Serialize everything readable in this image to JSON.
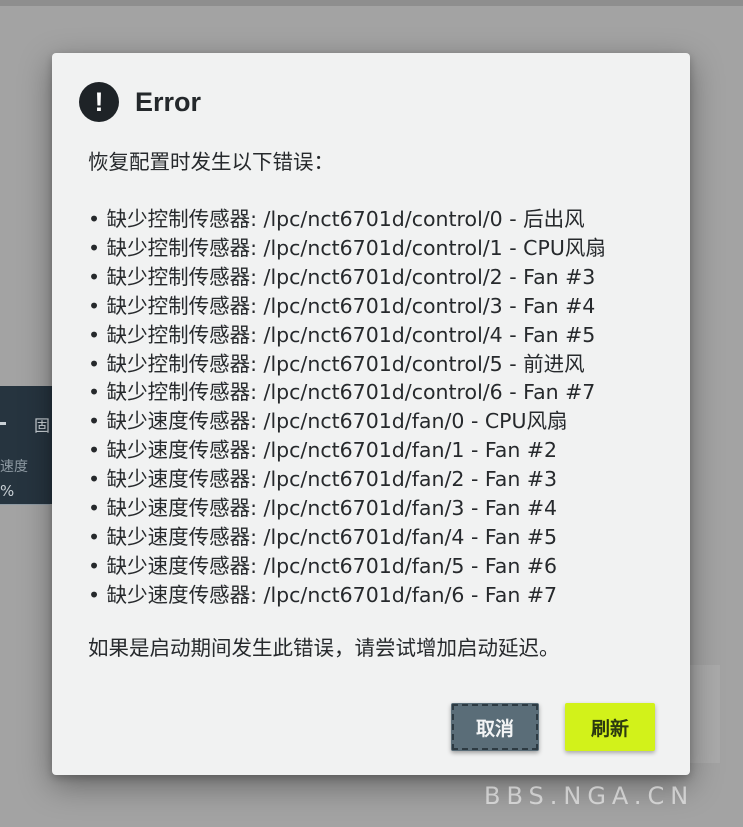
{
  "background": {
    "tab_label": "固",
    "speed_label": "速度",
    "percent_label": "%"
  },
  "dialog": {
    "title": "Error",
    "icon": "exclamation-icon",
    "intro": "恢复配置时发生以下错误：",
    "errors": [
      "• 缺少控制传感器: /lpc/nct6701d/control/0 - 后出风",
      "• 缺少控制传感器: /lpc/nct6701d/control/1 - CPU风扇",
      "• 缺少控制传感器: /lpc/nct6701d/control/2 - Fan #3",
      "• 缺少控制传感器: /lpc/nct6701d/control/3 - Fan #4",
      "• 缺少控制传感器: /lpc/nct6701d/control/4 - Fan #5",
      "• 缺少控制传感器: /lpc/nct6701d/control/5 - 前进风",
      "• 缺少控制传感器: /lpc/nct6701d/control/6 - Fan #7",
      "• 缺少速度传感器: /lpc/nct6701d/fan/0 - CPU风扇",
      "• 缺少速度传感器: /lpc/nct6701d/fan/1 - Fan #2",
      "• 缺少速度传感器: /lpc/nct6701d/fan/2 - Fan #3",
      "• 缺少速度传感器: /lpc/nct6701d/fan/3 - Fan #4",
      "• 缺少速度传感器: /lpc/nct6701d/fan/4 - Fan #5",
      "• 缺少速度传感器: /lpc/nct6701d/fan/5 - Fan #6",
      "• 缺少速度传感器: /lpc/nct6701d/fan/6 - Fan #7"
    ],
    "outro": "如果是启动期间发生此错误，请尝试增加启动延迟。",
    "buttons": {
      "cancel": "取消",
      "refresh": "刷新"
    }
  },
  "watermark": "BBS.NGA.CN",
  "colors": {
    "overlay": "#a3a3a3",
    "dialog_bg": "#f1f2f2",
    "cancel_bg": "#5a6d78",
    "refresh_bg": "#d2f21a"
  }
}
